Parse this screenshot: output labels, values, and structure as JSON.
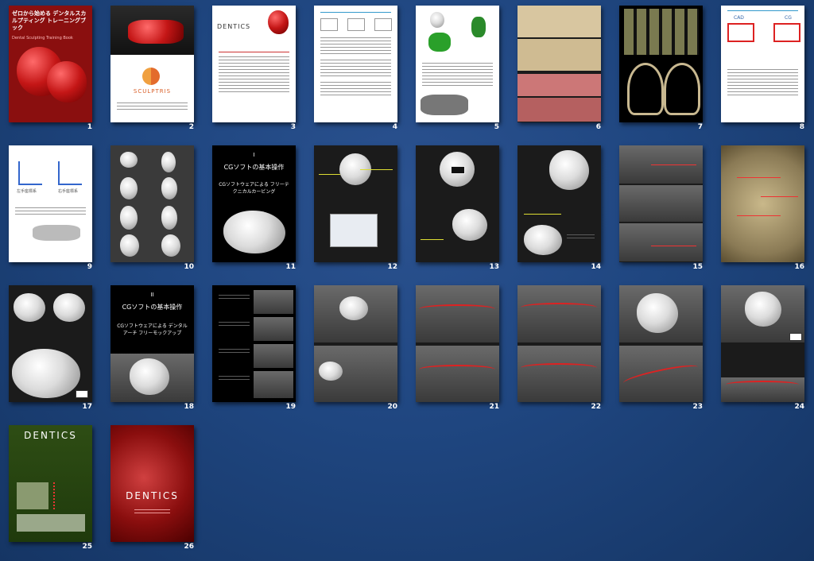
{
  "pages": [
    {
      "num": "1",
      "title": "ゼロから始める デンタルスカルプティング トレーニングブック",
      "subtitle": "Dental Sculpting Training Book"
    },
    {
      "num": "2",
      "logo_text": "SCULPTRIS"
    },
    {
      "num": "3",
      "logo_text": "DENTICS"
    },
    {
      "num": "4"
    },
    {
      "num": "5"
    },
    {
      "num": "6"
    },
    {
      "num": "7"
    },
    {
      "num": "8",
      "label_left": "CAD",
      "label_right": "CG"
    },
    {
      "num": "9",
      "label_left": "左手座標系",
      "label_right": "右手座標系"
    },
    {
      "num": "10"
    },
    {
      "num": "11",
      "chapter": "I",
      "title": "CGソフトの基本操作",
      "subtitle": "CGソフトウェアによる フリーテクニカルカービング"
    },
    {
      "num": "12"
    },
    {
      "num": "13"
    },
    {
      "num": "14"
    },
    {
      "num": "15"
    },
    {
      "num": "16"
    },
    {
      "num": "17"
    },
    {
      "num": "18",
      "chapter": "II",
      "title": "CGソフトの基本操作",
      "subtitle": "CGソフトウェアによる デンタルアーチ フリーモックアップ"
    },
    {
      "num": "19"
    },
    {
      "num": "20"
    },
    {
      "num": "21"
    },
    {
      "num": "22"
    },
    {
      "num": "23"
    },
    {
      "num": "24"
    },
    {
      "num": "25",
      "logo_text": "DENTICS"
    },
    {
      "num": "26",
      "logo_text": "DENTICS"
    }
  ],
  "colors": {
    "background": "#1f4680",
    "accent_red": "#c41616",
    "accent_green": "#2a8a2a"
  }
}
